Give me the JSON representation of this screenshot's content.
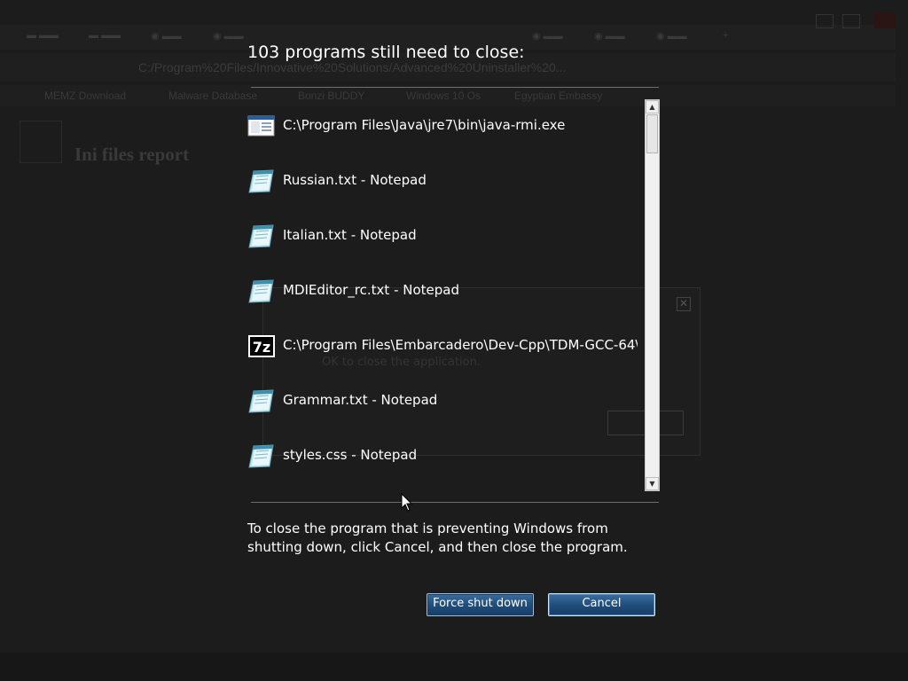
{
  "dialog": {
    "title": "103 programs still need to close:",
    "programs": [
      {
        "name": "C:\\Program Files\\Java\\jre7\\bin\\java-rmi.exe",
        "icon": "java-exe-icon"
      },
      {
        "name": "Russian.txt - Notepad",
        "icon": "notepad-icon"
      },
      {
        "name": "Italian.txt - Notepad",
        "icon": "notepad-icon"
      },
      {
        "name": "MDIEditor_rc.txt - Notepad",
        "icon": "notepad-icon"
      },
      {
        "name": "C:\\Program Files\\Embarcadero\\Dev-Cpp\\TDM-GCC-64\\...",
        "icon": "7zip-icon"
      },
      {
        "name": "Grammar.txt - Notepad",
        "icon": "notepad-icon"
      },
      {
        "name": "styles.css - Notepad",
        "icon": "notepad-icon"
      }
    ],
    "help_text": "To close the program that is preventing Windows from shutting down, click Cancel, and then close the program.",
    "force_button": "Force shut down",
    "cancel_button": "Cancel",
    "seven_zip_label": "7z"
  },
  "background": {
    "heading": "Ini files report",
    "url": "C:/Program%20Files/Innovative%20Solutions/Advanced%20Uninstaller%20...",
    "bookmarks": [
      "MEMZ Download",
      "Malware Database",
      "Bonzi BUDDY",
      "Windows 10 Os",
      "Egyptian Embassy"
    ],
    "error_text": "OK to close the application."
  },
  "colors": {
    "overlay_bg": "#1c1c1c",
    "button_blue": "#214e7c",
    "text": "#ffffff"
  }
}
